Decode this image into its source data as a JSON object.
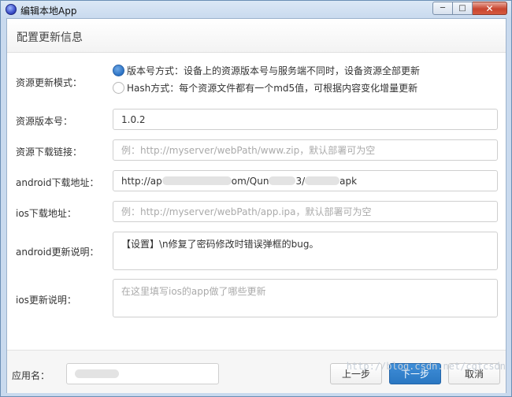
{
  "window": {
    "title": "编辑本地App",
    "min_glyph": "─",
    "max_glyph": "□",
    "close_glyph": "✕"
  },
  "header": {
    "title": "配置更新信息"
  },
  "form": {
    "update_mode": {
      "label": "资源更新模式：",
      "options": [
        {
          "text": "版本号方式：设备上的资源版本号与服务端不同时，设备资源全部更新",
          "selected": true
        },
        {
          "text": "Hash方式：每个资源文件都有一个md5值，可根据内容变化增量更新",
          "selected": false
        }
      ]
    },
    "resource_version": {
      "label": "资源版本号：",
      "value": "1.0.2",
      "placeholder": ""
    },
    "resource_url": {
      "label": "资源下载链接：",
      "value": "",
      "placeholder": "例：http://myserver/webPath/www.zip，默认部署可为空"
    },
    "android_url": {
      "label": "android下载地址：",
      "parts": [
        "http://ap",
        "om/Qun",
        "3/",
        "apk"
      ]
    },
    "ios_url": {
      "label": "ios下载地址：",
      "value": "",
      "placeholder": "例：http://myserver/webPath/app.ipa，默认部署可为空"
    },
    "android_notes": {
      "label": "android更新说明：",
      "value": "【设置】\\n修复了密码修改时错误弹框的bug。",
      "placeholder": ""
    },
    "ios_notes": {
      "label": "ios更新说明：",
      "value": "",
      "placeholder": "在这里填写ios的app做了哪些更新"
    }
  },
  "footer": {
    "app_name_label": "应用名：",
    "prev_label": "上一步",
    "next_label": "下一步",
    "cancel_label": "取消"
  },
  "watermark": "http://blog.csdn.net/cgtcsdn",
  "colors": {
    "accent": "#2a77c2",
    "title_bar": "#c9daee",
    "close": "#c8452f"
  }
}
